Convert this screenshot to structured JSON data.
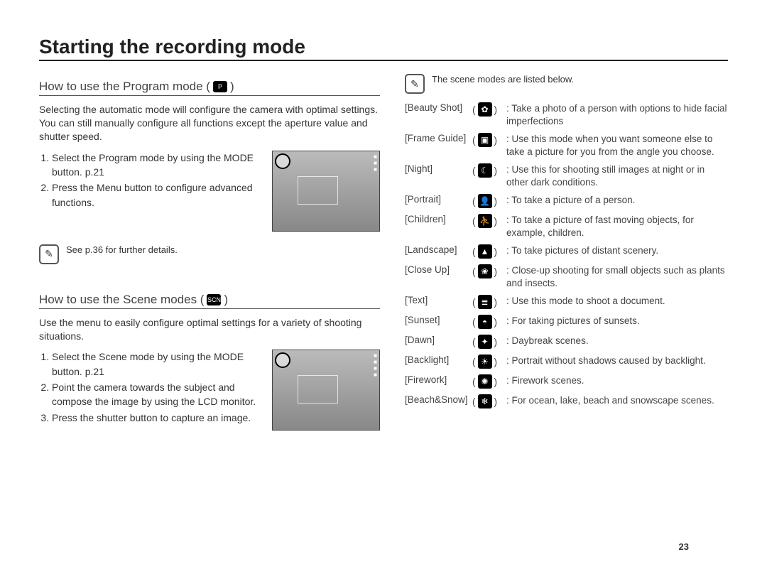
{
  "title": "Starting the recording mode",
  "page_number": "23",
  "program": {
    "heading_pre": "How to use the Program mode (",
    "heading_post": " )",
    "intro": "Selecting the automatic mode will configure the camera with optimal settings. You can still manually configure all functions except the aperture value and shutter speed.",
    "steps": [
      "Select the Program mode by using the MODE button. p.21",
      "Press the Menu button to configure advanced functions."
    ],
    "note": "See p.36 for further details."
  },
  "scene": {
    "heading_pre": "How to use the Scene modes (",
    "heading_post": " )",
    "intro": "Use the menu to easily configure optimal settings for a variety of shooting situations.",
    "steps": [
      "Select the Scene mode by using the MODE button. p.21",
      "Point the camera towards the subject and compose the image by using the LCD monitor.",
      "Press the shutter button to capture an image."
    ]
  },
  "listnote": "The scene modes are listed below.",
  "modes": [
    {
      "label": "[Beauty Shot]",
      "icon": "beauty-icon",
      "glyph": "✿",
      "desc": "Take a photo of a person with options to hide facial imperfections"
    },
    {
      "label": "[Frame Guide]",
      "icon": "frame-guide-icon",
      "glyph": "▣",
      "desc": "Use this mode when you want someone else to take a picture for you from the angle you choose."
    },
    {
      "label": "[Night]",
      "icon": "night-icon",
      "glyph": "☾",
      "desc": "Use this for shooting still images at night or in other dark conditions."
    },
    {
      "label": "[Portrait]",
      "icon": "portrait-icon",
      "glyph": "👤",
      "desc": "To take a picture of a person."
    },
    {
      "label": "[Children]",
      "icon": "children-icon",
      "glyph": "⛹",
      "desc": "To take a picture of fast moving objects, for example, children."
    },
    {
      "label": "[Landscape]",
      "icon": "landscape-icon",
      "glyph": "▲",
      "desc": "To take pictures of distant scenery."
    },
    {
      "label": "[Close Up]",
      "icon": "closeup-icon",
      "glyph": "❀",
      "desc": "Close-up shooting for small objects such as plants and insects."
    },
    {
      "label": "[Text]",
      "icon": "text-icon",
      "glyph": "≣",
      "desc": "Use this mode to shoot a document."
    },
    {
      "label": "[Sunset]",
      "icon": "sunset-icon",
      "glyph": "◓",
      "desc": "For taking pictures of sunsets."
    },
    {
      "label": "[Dawn]",
      "icon": "dawn-icon",
      "glyph": "✦",
      "desc": "Daybreak scenes."
    },
    {
      "label": "[Backlight]",
      "icon": "backlight-icon",
      "glyph": "☀",
      "desc": "Portrait without shadows caused by backlight."
    },
    {
      "label": "[Firework]",
      "icon": "firework-icon",
      "glyph": "✺",
      "desc": "Firework scenes."
    },
    {
      "label": "[Beach&Snow]",
      "icon": "beach-snow-icon",
      "glyph": "❄",
      "desc": "For ocean, lake, beach and snowscape scenes."
    }
  ]
}
